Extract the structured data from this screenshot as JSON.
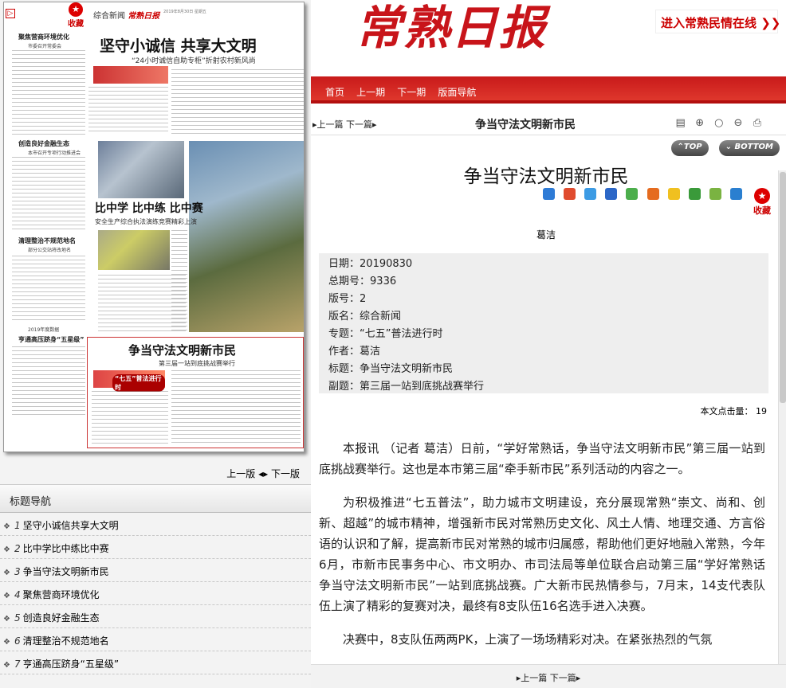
{
  "left": {
    "thumbnail": {
      "fav_label": "收藏",
      "header_section": "综合新闻",
      "header_paper": "常熟日报",
      "header_date": "2019年8月30日 星期五",
      "headline1": "坚守小诚信  共享大文明",
      "headline1_sub": "“24小时诚信自助专柜”折射农村新风尚",
      "headline2": "比中学  比中练  比中赛",
      "headline2_sub": "安全生产综合执法演练竞赛精彩上演",
      "headline3": "争当守法文明新市民",
      "headline3_sub": "第三届一站到底挑战赛举行",
      "banner2_text": "“七五”普法进行时",
      "side_headlines": [
        {
          "title": "聚焦营商环境优化",
          "sub": "市委召开常委会"
        },
        {
          "title": "创造良好金融生态",
          "sub": "本市召开专项行动推进会"
        },
        {
          "title": "清理整治不规范地名",
          "sub": "部分公交站将改地名"
        },
        {
          "title": "亨通高压跻身“五星级”",
          "sub": "2019年度数据"
        }
      ]
    },
    "pager": {
      "prev": "上一版",
      "next": "下一版"
    },
    "title_nav": {
      "header": "标题导航",
      "items": [
        {
          "num": "1",
          "label": "坚守小诚信共享大文明"
        },
        {
          "num": "2",
          "label": "比中学比中练比中赛"
        },
        {
          "num": "3",
          "label": "争当守法文明新市民"
        },
        {
          "num": "4",
          "label": "聚焦营商环境优化"
        },
        {
          "num": "5",
          "label": "创造良好金融生态"
        },
        {
          "num": "6",
          "label": "清理整治不规范地名"
        },
        {
          "num": "7",
          "label": "亨通高压跻身“五星级”"
        }
      ]
    }
  },
  "right": {
    "logo": "常熟日报",
    "enter_link": "进入常熟民情在线 ❯❯",
    "nav": [
      "首页",
      "上一期",
      "下一期",
      "版面导航"
    ],
    "toolbar": {
      "prev": "上一篇",
      "next": "下一篇",
      "title": "争当守法文明新市民"
    },
    "top_label": "TOP",
    "bottom_label": "BOTTOM",
    "article": {
      "title": "争当守法文明新市民",
      "fav_label": "收藏",
      "author": "葛洁",
      "meta": [
        {
          "key": "日期",
          "value": "20190830"
        },
        {
          "key": "总期号",
          "value": "9336"
        },
        {
          "key": "版号",
          "value": "2"
        },
        {
          "key": "版名",
          "value": "综合新闻"
        },
        {
          "key": "专题",
          "value": "“七五”普法进行时"
        },
        {
          "key": "作者",
          "value": "葛洁"
        },
        {
          "key": "标题",
          "value": "争当守法文明新市民"
        },
        {
          "key": "副题",
          "value": "第三届一站到底挑战赛举行"
        }
      ],
      "clicks_label": "本文点击量：",
      "clicks": "19",
      "paragraphs": [
        "本报讯 （记者 葛洁）日前，“学好常熟话，争当守法文明新市民”第三届一站到底挑战赛举行。这也是本市第三届“牵手新市民”系列活动的内容之一。",
        "为积极推进“七五普法”，助力城市文明建设，充分展现常熟“崇文、尚和、创新、超越”的城市精神，增强新市民对常熟历史文化、风土人情、地理交通、方言俗语的认识和了解，提高新市民对常熟的城市归属感，帮助他们更好地融入常熟，今年6月，市新市民事务中心、市文明办、市司法局等单位联合启动第三届“学好常熟话 争当守法文明新市民”一站到底挑战赛。广大新市民热情参与，7月末，14支代表队伍上演了精彩的复赛对决，最终有8支队伍16名选手进入决赛。",
        "决赛中，8支队伍两两PK，上演了一场场精彩对决。在紧张热烈的气氛"
      ]
    },
    "footer": {
      "prev": "上一篇",
      "next": "下一篇"
    }
  }
}
